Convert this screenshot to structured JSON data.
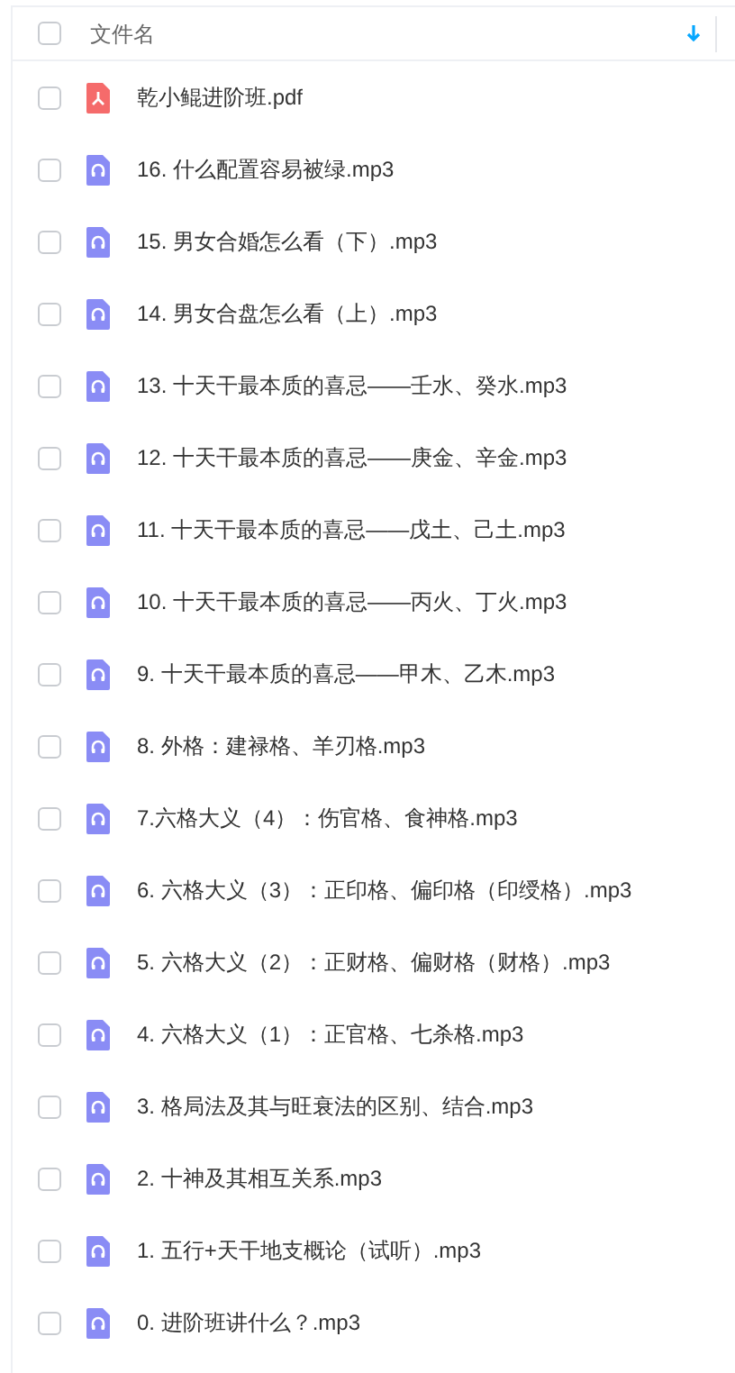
{
  "header": {
    "checked": false,
    "column_1": "文件名",
    "sort_descending": true
  },
  "files": [
    {
      "kind": "pdf",
      "name": "乾小鲲进阶班.pdf",
      "checked": false
    },
    {
      "kind": "audio",
      "name": "16. 什么配置容易被绿.mp3",
      "checked": false
    },
    {
      "kind": "audio",
      "name": "15. 男女合婚怎么看（下）.mp3",
      "checked": false
    },
    {
      "kind": "audio",
      "name": "14. 男女合盘怎么看（上）.mp3",
      "checked": false
    },
    {
      "kind": "audio",
      "name": "13. 十天干最本质的喜忌——壬水、癸水.mp3",
      "checked": false
    },
    {
      "kind": "audio",
      "name": "12. 十天干最本质的喜忌——庚金、辛金.mp3",
      "checked": false
    },
    {
      "kind": "audio",
      "name": "11. 十天干最本质的喜忌——戊土、己土.mp3",
      "checked": false
    },
    {
      "kind": "audio",
      "name": "10. 十天干最本质的喜忌——丙火、丁火.mp3",
      "checked": false
    },
    {
      "kind": "audio",
      "name": "9. 十天干最本质的喜忌——甲木、乙木.mp3",
      "checked": false
    },
    {
      "kind": "audio",
      "name": "8. 外格：建禄格、羊刃格.mp3",
      "checked": false
    },
    {
      "kind": "audio",
      "name": "7.六格大义（4）：伤官格、食神格.mp3",
      "checked": false
    },
    {
      "kind": "audio",
      "name": "6. 六格大义（3）：正印格、偏印格（印绶格）.mp3",
      "checked": false
    },
    {
      "kind": "audio",
      "name": "5. 六格大义（2）：正财格、偏财格（财格）.mp3",
      "checked": false
    },
    {
      "kind": "audio",
      "name": "4. 六格大义（1）：正官格、七杀格.mp3",
      "checked": false
    },
    {
      "kind": "audio",
      "name": "3. 格局法及其与旺衰法的区别、结合.mp3",
      "checked": false
    },
    {
      "kind": "audio",
      "name": "2. 十神及其相互关系.mp3",
      "checked": false
    },
    {
      "kind": "audio",
      "name": "1. 五行+天干地支概论（试听）.mp3",
      "checked": false
    },
    {
      "kind": "audio",
      "name": "0. 进阶班讲什么？.mp3",
      "checked": false
    }
  ]
}
